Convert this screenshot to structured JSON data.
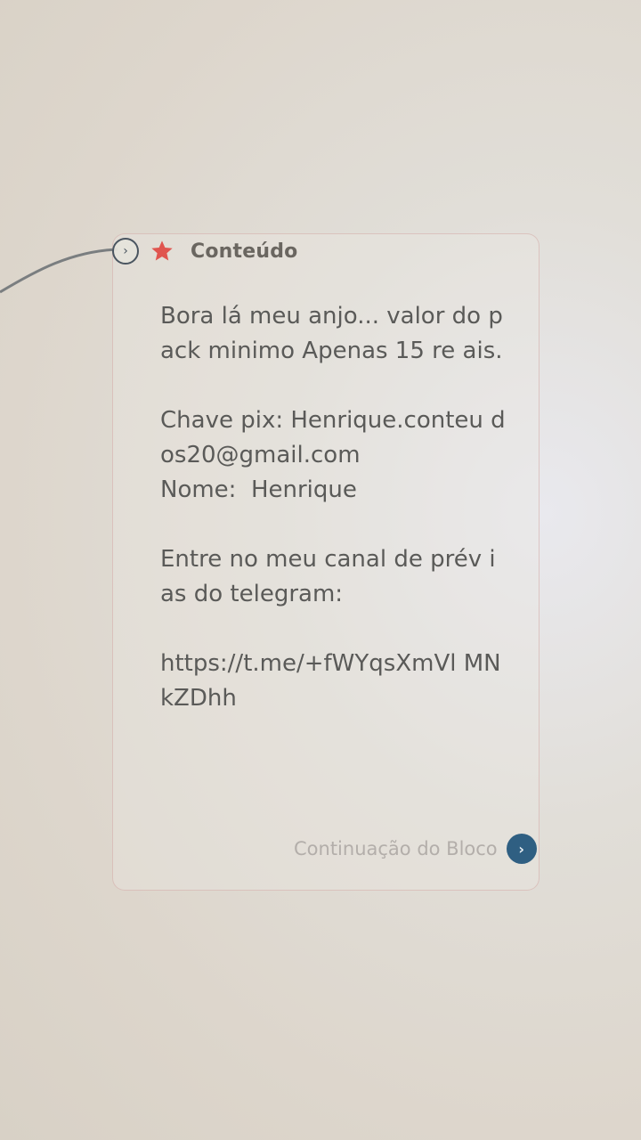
{
  "block": {
    "title": "Conteúdo",
    "message": "Bora lá meu anjo... valor do pack minimo Apenas 15 re ais.\n\nChave pix: Henrique.conteu dos20@gmail.com\nNome:  Henrique\n\nEntre no meu canal de prév ias do telegram:\n\nhttps://t.me/+fWYqsXmVl MNkZDhh",
    "continue_label": "Continuação do Bloco"
  },
  "icons": {
    "collapse": "chevron-right-icon",
    "star": "star-icon",
    "continue": "chevron-right-icon"
  },
  "colors": {
    "star": "#e0554f",
    "continue_button": "#2f5f82",
    "text": "#5a5a58"
  }
}
